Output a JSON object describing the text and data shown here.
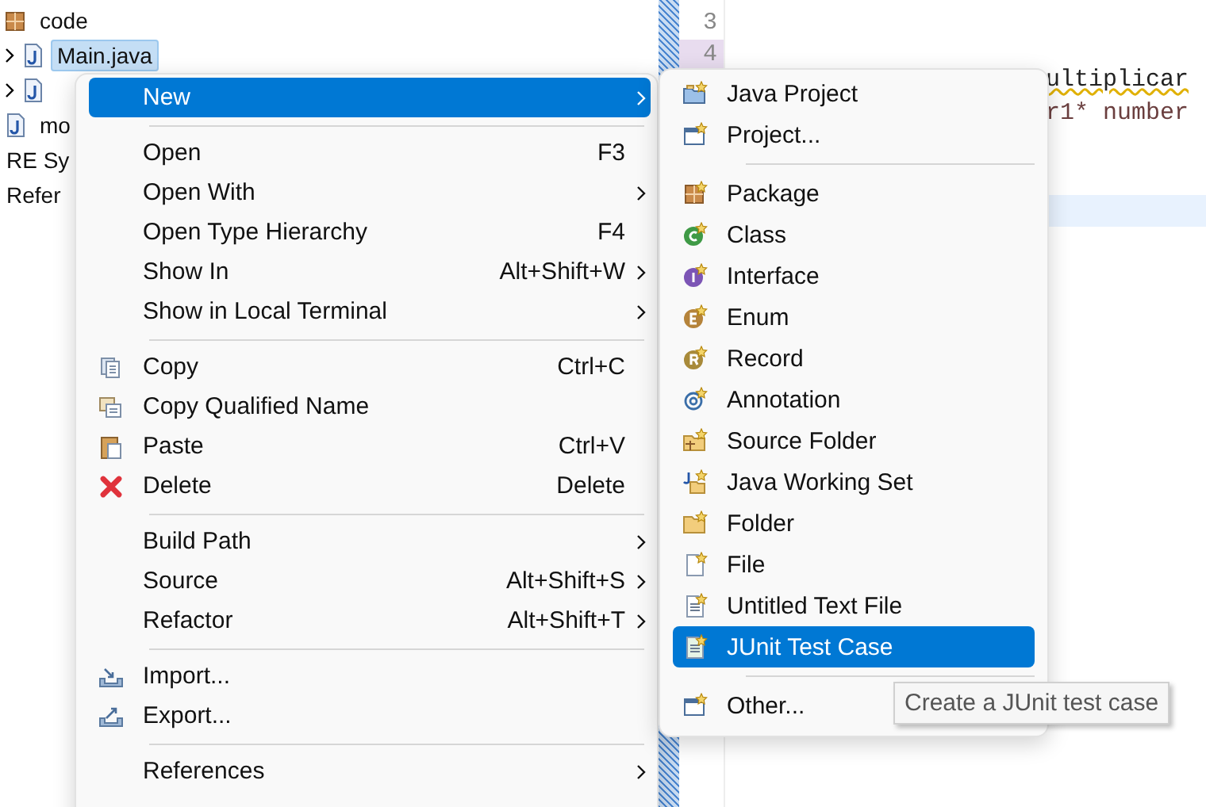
{
  "tree": {
    "items": [
      {
        "label": "code",
        "kind": "package"
      },
      {
        "label": "Main.java",
        "kind": "java",
        "expandable": true,
        "selected": true
      },
      {
        "kind": "java",
        "expandable": true
      },
      {
        "label": "mo",
        "kind": "java"
      },
      {
        "label": "RE Sy",
        "kind": "text"
      },
      {
        "label": "Refer",
        "kind": "text"
      }
    ]
  },
  "editor": {
    "line_numbers": [
      {
        "label": "3",
        "current": false
      },
      {
        "label": "4",
        "current": true
      }
    ],
    "lines": [
      {
        "text": "ultiplicar",
        "warning": true
      },
      {
        "text": "r1* number",
        "warning": false
      }
    ]
  },
  "context_menu": {
    "groups": [
      [
        {
          "label": "New",
          "submenu": true,
          "selected": true
        }
      ],
      [
        {
          "label": "Open",
          "shortcut": "F3",
          "submenu": false,
          "selected": false
        },
        {
          "label": "Open With",
          "submenu": true,
          "selected": false
        },
        {
          "label": "Open Type Hierarchy",
          "shortcut": "F4",
          "submenu": false,
          "selected": false
        },
        {
          "label": "Show In",
          "shortcut": "Alt+Shift+W",
          "submenu": true,
          "selected": false
        },
        {
          "label": "Show in Local Terminal",
          "submenu": true,
          "selected": false
        }
      ],
      [
        {
          "label": "Copy",
          "shortcut": "Ctrl+C",
          "submenu": false,
          "selected": false
        },
        {
          "label": "Copy Qualified Name",
          "submenu": false,
          "selected": false
        },
        {
          "label": "Paste",
          "shortcut": "Ctrl+V",
          "submenu": false,
          "selected": false
        },
        {
          "label": "Delete",
          "shortcut": "Delete",
          "submenu": false,
          "selected": false
        }
      ],
      [
        {
          "label": "Build Path",
          "submenu": true,
          "selected": false
        },
        {
          "label": "Source",
          "shortcut": "Alt+Shift+S",
          "submenu": true,
          "selected": false
        },
        {
          "label": "Refactor",
          "shortcut": "Alt+Shift+T",
          "submenu": true,
          "selected": false
        }
      ],
      [
        {
          "label": "Import...",
          "submenu": false,
          "selected": false
        },
        {
          "label": "Export...",
          "submenu": false,
          "selected": false
        }
      ],
      [
        {
          "label": "References",
          "submenu": true,
          "selected": false
        }
      ]
    ]
  },
  "new_submenu": {
    "groups": [
      [
        {
          "label": "Java Project",
          "selected": false
        },
        {
          "label": "Project...",
          "selected": false
        }
      ],
      [
        {
          "label": "Package",
          "selected": false
        },
        {
          "label": "Class",
          "selected": false
        },
        {
          "label": "Interface",
          "selected": false
        },
        {
          "label": "Enum",
          "selected": false
        },
        {
          "label": "Record",
          "selected": false
        },
        {
          "label": "Annotation",
          "selected": false
        },
        {
          "label": "Source Folder",
          "selected": false
        },
        {
          "label": "Java Working Set",
          "selected": false
        },
        {
          "label": "Folder",
          "selected": false
        },
        {
          "label": "File",
          "selected": false
        },
        {
          "label": "Untitled Text File",
          "selected": false
        },
        {
          "label": "JUnit Test Case",
          "selected": true
        }
      ],
      [
        {
          "label": "Other...",
          "selected": false
        }
      ]
    ]
  },
  "tooltip": {
    "text": "Create a JUnit test case"
  }
}
